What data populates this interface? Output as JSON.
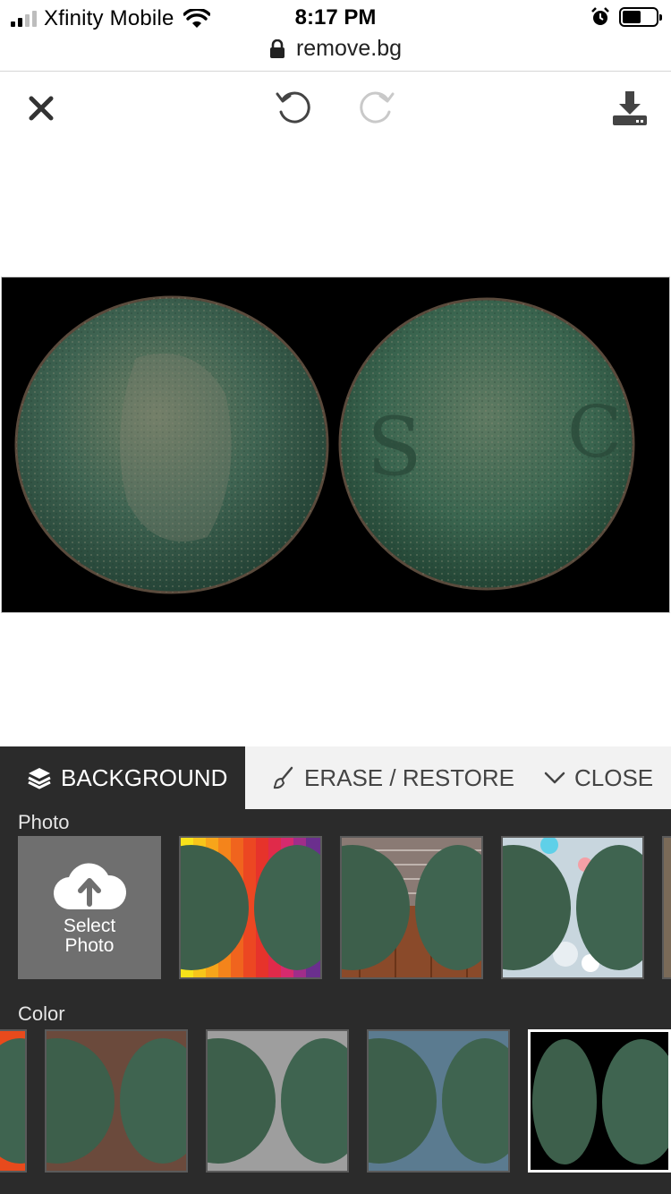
{
  "status_bar": {
    "carrier": "Xfinity Mobile",
    "time": "8:17 PM",
    "url": "remove.bg"
  },
  "toolbar": {
    "close_icon": "close-icon",
    "undo_icon": "undo-icon",
    "redo_icon": "redo-icon",
    "download_icon": "download-icon"
  },
  "tabs": {
    "background": "BACKGROUND",
    "erase_restore": "ERASE / RESTORE",
    "close": "CLOSE"
  },
  "sections": {
    "photo_label": "Photo",
    "select_photo_line1": "Select",
    "select_photo_line2": "Photo",
    "color_label": "Color"
  },
  "photo_backgrounds": [
    "rainbow-stripes",
    "brick-wall-wood-floor",
    "bokeh-lights"
  ],
  "color_swatches": [
    "#e84a1c",
    "#6b4a3c",
    "#9e9e9e",
    "#5b7b90",
    "#000000"
  ],
  "selected_color": "#000000"
}
